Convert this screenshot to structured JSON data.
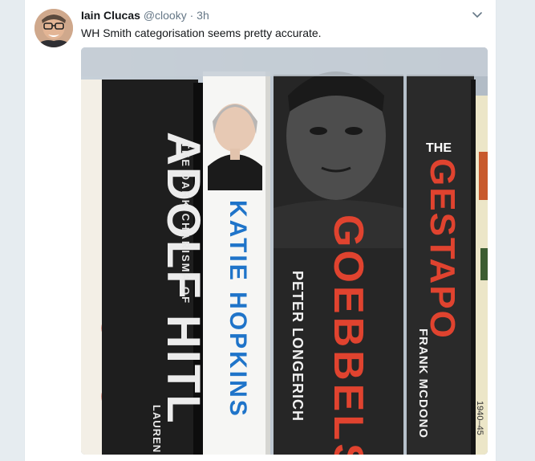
{
  "tweet": {
    "author": {
      "full_name": "Iain Clucas",
      "handle": "@clooky",
      "separator": "·",
      "time": "3h"
    },
    "text": "WH Smith categorisation seems pretty accurate.",
    "caret_icon": "chevron-down-icon"
  },
  "photo": {
    "spines": {
      "adolf_series": "THE DARK CHARISMA OF",
      "adolf_title": "ADOLF HITL",
      "adolf_author": "LAUREN",
      "katie_title": "KATIE HOPKINS",
      "goebbels_author": "PETER LONGERICH",
      "goebbels_title": "GOEBBELS",
      "gestapo_the": "THE",
      "gestapo_title": "GESTAPO",
      "gestapo_author": "FRANK MCDONO",
      "right_years": "1940–45",
      "left_fragment": "OTICE"
    }
  },
  "colors": {
    "name": "#14171a",
    "muted": "#657786",
    "red_title": "#e0432f",
    "blue_title": "#1f74c9"
  }
}
